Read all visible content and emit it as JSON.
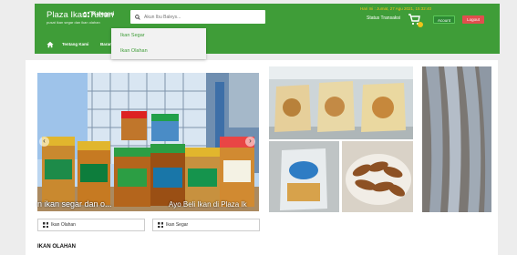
{
  "header": {
    "brand_title": "Plaza Ikan Tuban",
    "brand_sub": "pusat ikan segar dan ikan olahan",
    "kategori_label": "Kategori",
    "search_placeholder": "Akun Ibu Baleys...",
    "user_info": "Hari Ini : Jumat, 27 Agu 2021, 15:32:40",
    "status_label": "Status Transaksi",
    "akun_label": "Acount",
    "logout_label": "Logout"
  },
  "subnav": {
    "tentang_label": "Tentang Kami",
    "bara_label": "Barang"
  },
  "dropdown": {
    "items": [
      "Ikan Segar",
      "Ikan Olahan"
    ]
  },
  "slider": {
    "caption_left": "n ikan segar dan o...",
    "caption_right": "Ayo Beli Ikan di Plaza Ik"
  },
  "categories": {
    "btn1": "Ikan Olahan",
    "btn2": "Ikan Segar"
  },
  "section": {
    "title": "IKAN OLAHAN"
  },
  "colors": {
    "primary_green": "#3f9d38",
    "logout_red": "#e14e4e",
    "badge_yellow": "#f0c419"
  }
}
